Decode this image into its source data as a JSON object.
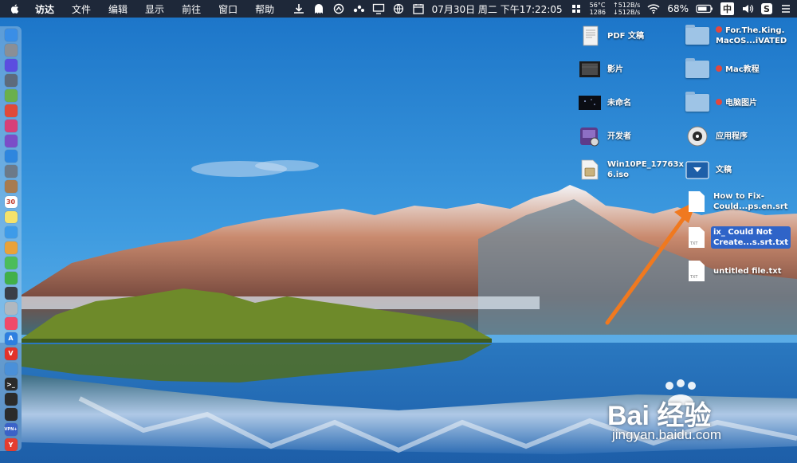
{
  "menubar": {
    "app_name": "访达",
    "menu": [
      "文件",
      "编辑",
      "显示",
      "前往",
      "窗口",
      "帮助"
    ],
    "cpu_temp": "56°C",
    "cpu_rpm": "1286",
    "net_up": "↑512B/s",
    "net_down": "↓512B/s",
    "datetime": "07月30日 周二 下午17:22:05",
    "battery": "68%",
    "input_method": "中",
    "s_badge": "S"
  },
  "dock": [
    {
      "name": "finder",
      "color": "#3a8ee6",
      "glyph": ""
    },
    {
      "name": "system-prefs",
      "color": "#8a8f96",
      "glyph": ""
    },
    {
      "name": "siri",
      "color": "#5b4de0",
      "glyph": ""
    },
    {
      "name": "launchpad",
      "color": "#5d6b7c",
      "glyph": ""
    },
    {
      "name": "android-file",
      "color": "#6ab04c",
      "glyph": ""
    },
    {
      "name": "chrome",
      "color": "#e04a3a",
      "glyph": ""
    },
    {
      "name": "app-pink",
      "color": "#d64078",
      "glyph": ""
    },
    {
      "name": "app-purple",
      "color": "#7b4dc8",
      "glyph": ""
    },
    {
      "name": "safari",
      "color": "#2e86de",
      "glyph": ""
    },
    {
      "name": "preview",
      "color": "#6c7a89",
      "glyph": ""
    },
    {
      "name": "notes-brown",
      "color": "#a87b4f",
      "glyph": ""
    },
    {
      "name": "calendar",
      "color": "#ffffff",
      "glyph": "30"
    },
    {
      "name": "stickies",
      "color": "#f5e26b",
      "glyph": ""
    },
    {
      "name": "photos-app",
      "color": "#3d9be9",
      "glyph": ""
    },
    {
      "name": "photos",
      "color": "#e8a23a",
      "glyph": ""
    },
    {
      "name": "messages",
      "color": "#4bbd5b",
      "glyph": ""
    },
    {
      "name": "wechat",
      "color": "#42b04a",
      "glyph": ""
    },
    {
      "name": "app-dark",
      "color": "#3a3f48",
      "glyph": ""
    },
    {
      "name": "app-gray",
      "color": "#b0b8c0",
      "glyph": ""
    },
    {
      "name": "music",
      "color": "#f04a6a",
      "glyph": ""
    },
    {
      "name": "app-store",
      "color": "#2d7fe0",
      "glyph": "A"
    },
    {
      "name": "vivaldi",
      "color": "#e2322b",
      "glyph": "V"
    },
    {
      "name": "finder-2",
      "color": "#4a90d9",
      "glyph": ""
    },
    {
      "name": "terminal",
      "color": "#2b2b2b",
      "glyph": ">_"
    },
    {
      "name": "terminal-2",
      "color": "#2b2b2b",
      "glyph": ""
    },
    {
      "name": "console",
      "color": "#2b2b2b",
      "glyph": ""
    },
    {
      "name": "vpn",
      "color": "#3a62c8",
      "glyph": "VPN+"
    },
    {
      "name": "yandex",
      "color": "#e43d2f",
      "glyph": "Y"
    }
  ],
  "desktop_icons": [
    {
      "id": "pdf",
      "label": "PDF 文稿",
      "kind": "pdf",
      "tag": false
    },
    {
      "id": "movies",
      "label": "影片",
      "kind": "movies",
      "tag": false
    },
    {
      "id": "untitled",
      "label": "未命名",
      "kind": "dark",
      "tag": false
    },
    {
      "id": "developer",
      "label": "开发者",
      "kind": "dev",
      "tag": false
    },
    {
      "id": "iso",
      "label": "Win10PE_17763x\n6.iso",
      "kind": "iso",
      "tag": false
    },
    {
      "id": "for-the-king",
      "label": "For.The.King.\nMacOS...iVATED",
      "kind": "folder",
      "tag": true
    },
    {
      "id": "mac-tutorial",
      "label": "Mac教程",
      "kind": "folder",
      "tag": true
    },
    {
      "id": "pc-pictures",
      "label": "电脑图片",
      "kind": "folder",
      "tag": true
    },
    {
      "id": "applications",
      "label": "应用程序",
      "kind": "apps",
      "tag": false
    },
    {
      "id": "documents",
      "label": "文稿",
      "kind": "docs",
      "tag": false
    },
    {
      "id": "srt",
      "label": "How to Fix-\nCould...ps.en.srt",
      "kind": "file",
      "tag": false
    },
    {
      "id": "srt-txt",
      "label": "ix_ Could Not\nCreate...s.srt.txt",
      "kind": "file-selected",
      "tag": false
    },
    {
      "id": "untitled-txt",
      "label": "untitled file.txt",
      "kind": "file",
      "tag": false
    }
  ],
  "watermark": {
    "logo_text": "Bai 经验",
    "url": "jingyan.baidu.com"
  }
}
